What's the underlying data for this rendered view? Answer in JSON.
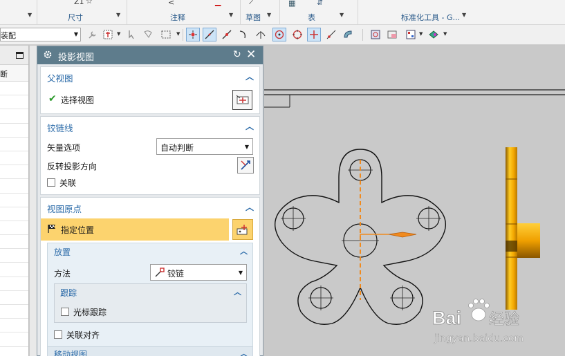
{
  "ribbon": {
    "groups": [
      {
        "label": "尺寸"
      },
      {
        "label": "注释"
      },
      {
        "label": "草图"
      },
      {
        "label": "表"
      },
      {
        "label": "标准化工具 - G..."
      }
    ],
    "partial_glyph": "Z1"
  },
  "toolbar": {
    "combo_value": "装配"
  },
  "navigator": {
    "column_header": "断"
  },
  "dialog": {
    "title": "投影视图",
    "parent_view": {
      "header": "父视图",
      "select_view_label": "选择视图"
    },
    "hinge_line": {
      "header": "铰链线",
      "vector_option_label": "矢量选项",
      "vector_option_value": "自动判断",
      "reverse_direction_label": "反转投影方向",
      "associative_label": "关联",
      "associative_checked": false
    },
    "view_origin": {
      "header": "视图原点",
      "specify_location_label": "指定位置",
      "placement": {
        "header": "放置",
        "method_label": "方法",
        "method_value": "铰链",
        "tracking": {
          "header": "跟踪",
          "cursor_tracking_label": "光标跟踪",
          "cursor_tracking_checked": false
        },
        "associative_align_label": "关联对齐",
        "associative_align_checked": false
      },
      "move_view_header": "移动视图"
    }
  },
  "watermark": {
    "brand": "Bai",
    "brand_suffix": "经验",
    "url": "jingyan.baidu.com"
  },
  "colors": {
    "accent": "#2a6aa8",
    "title_bar": "#5e7c8c",
    "highlight": "#fcd36e",
    "hinge": "#f08a1e",
    "canvas": "#c9c9c9"
  }
}
